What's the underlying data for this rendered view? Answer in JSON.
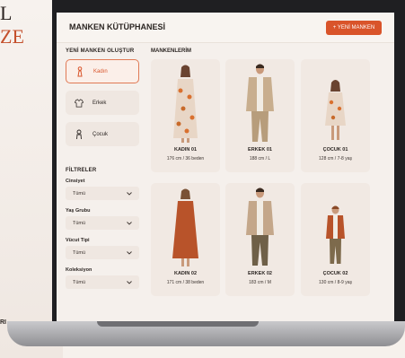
{
  "background": {
    "letters": [
      "L",
      "ZE"
    ],
    "bottom_text": "RI"
  },
  "app": {
    "title": "MANKEN KÜTÜPHANESİ",
    "new_button": "+ YENİ MANKEN",
    "accent": "#d9542a"
  },
  "sidebar": {
    "create_title": "YENİ MANKEN OLUŞTUR",
    "options": [
      {
        "label": "Kadın",
        "icon": "woman-figure-icon",
        "active": true
      },
      {
        "label": "Erkek",
        "icon": "shirt-icon",
        "active": false
      },
      {
        "label": "Çocuk",
        "icon": "child-figure-icon",
        "active": false
      }
    ],
    "filters_title": "FİLTRELER",
    "filters": [
      {
        "label": "Cinsiyet",
        "value": "Tümü"
      },
      {
        "label": "Yaş Grubu",
        "value": "Tümü"
      },
      {
        "label": "Vücut Tipi",
        "value": "Tümü"
      },
      {
        "label": "Koleksiyon",
        "value": "Tümü"
      }
    ]
  },
  "main": {
    "title": "MANKENLERİM",
    "cards": [
      {
        "name": "KADIN 01",
        "measure": "176 cm / 36 beden"
      },
      {
        "name": "ERKEK 01",
        "measure": "188 cm / L"
      },
      {
        "name": "ÇOCUK 01",
        "measure": "128 cm / 7-8 yaş"
      },
      {
        "name": "KADIN 02",
        "measure": "171 cm / 38 beden"
      },
      {
        "name": "ERKEK 02",
        "measure": "183 cm / M"
      },
      {
        "name": "ÇOCUK 02",
        "measure": "130 cm / 8-9 yaş"
      }
    ]
  }
}
